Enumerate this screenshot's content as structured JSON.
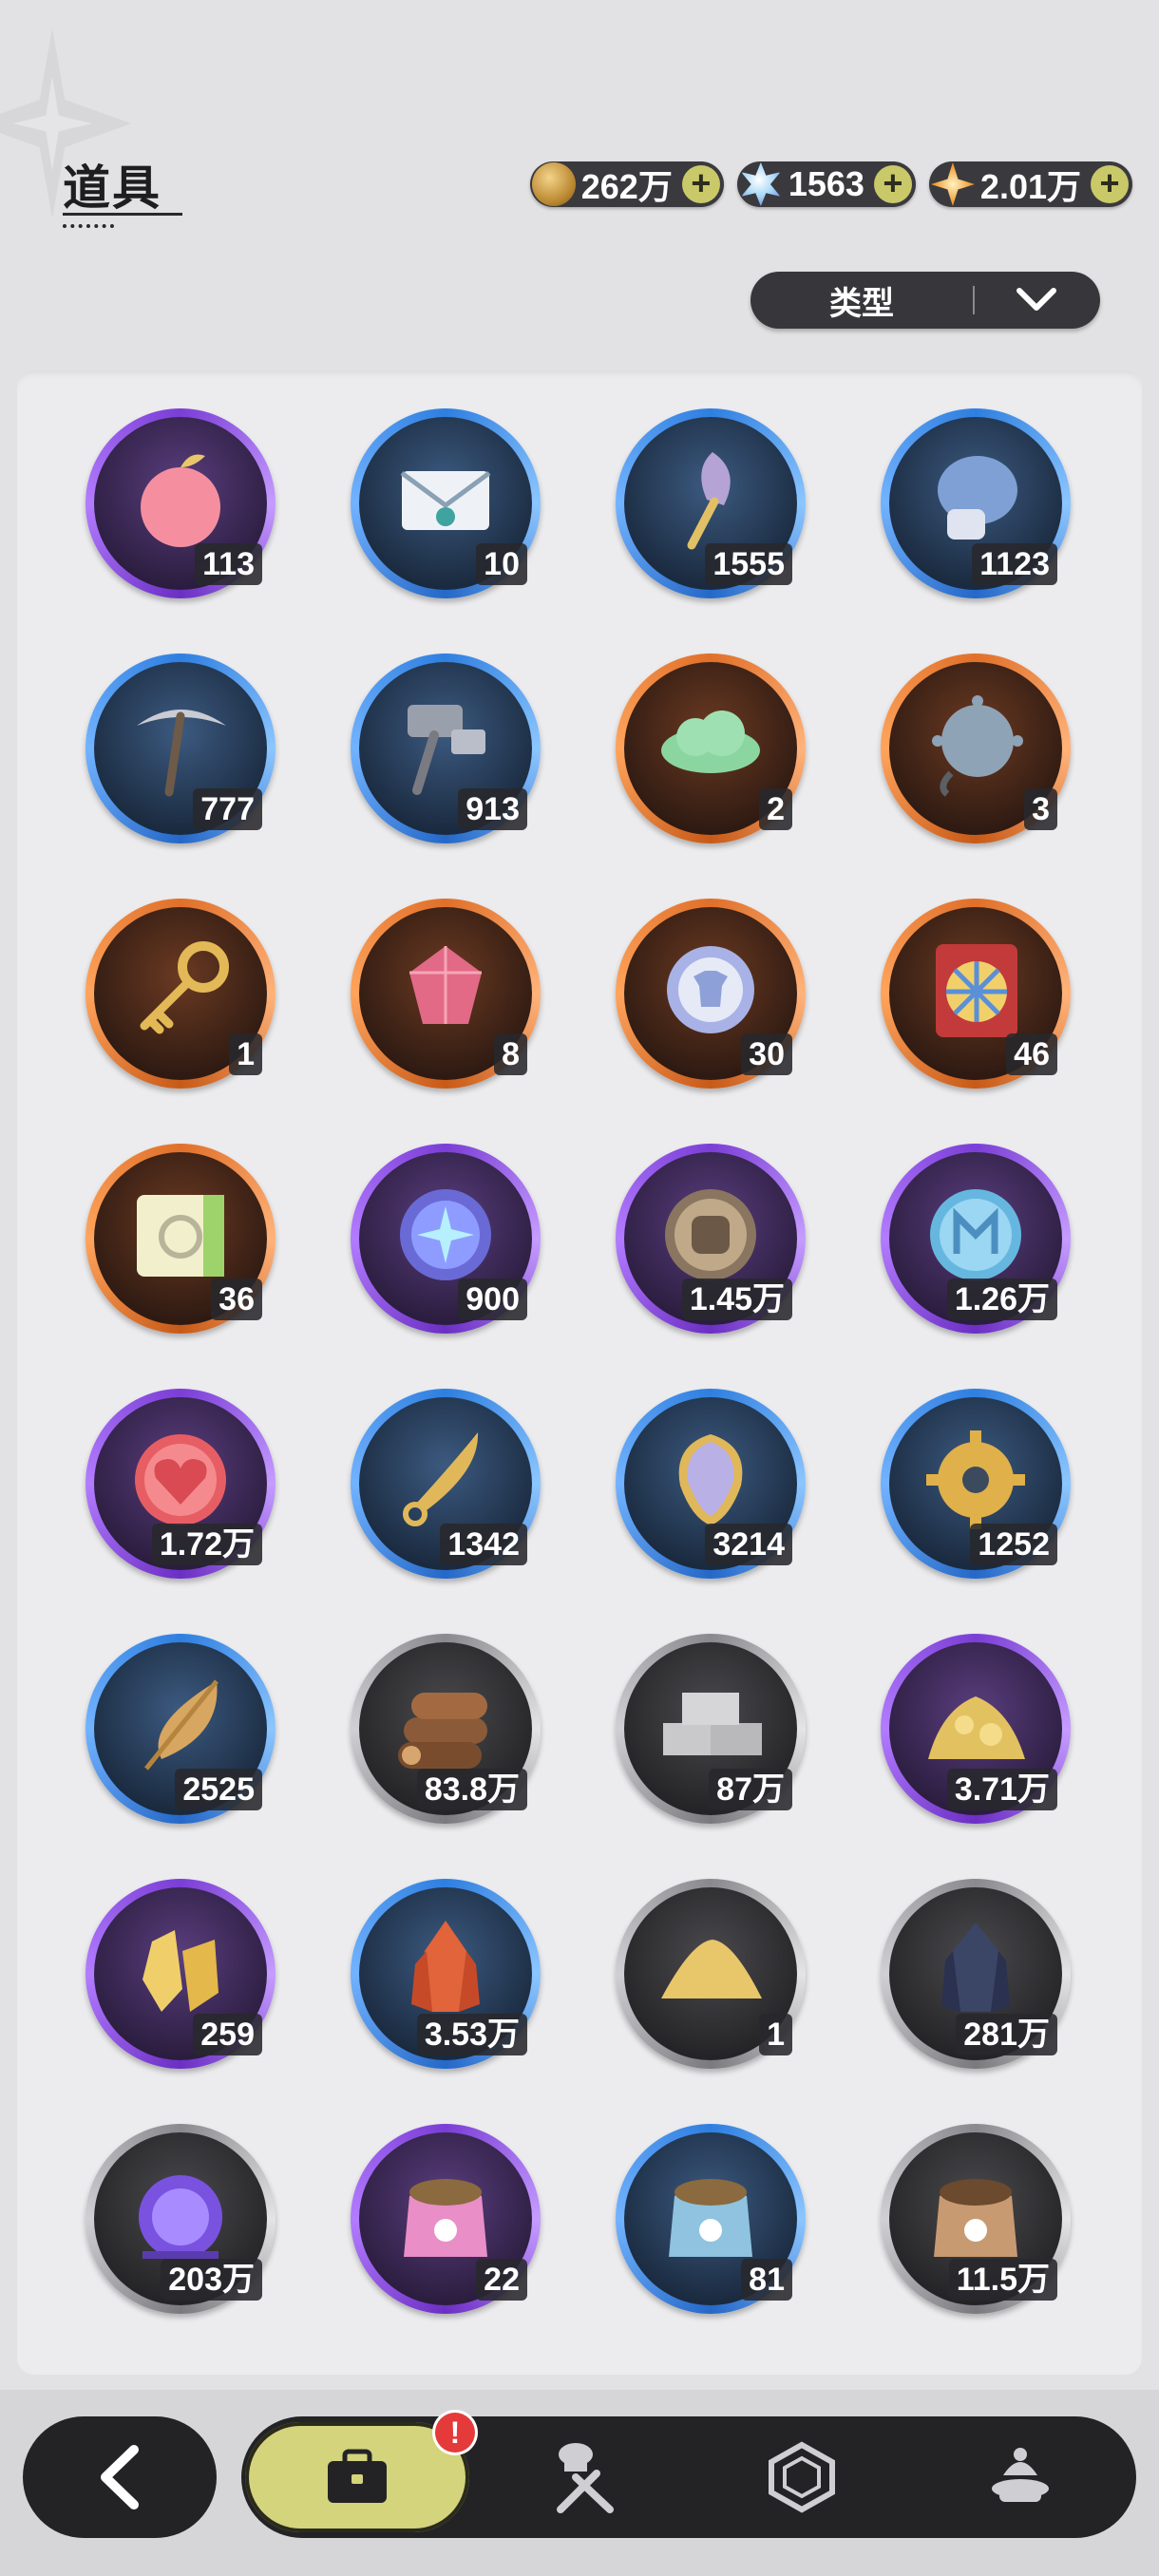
{
  "header": {
    "title": "道具"
  },
  "currencies": [
    {
      "icon": "gold-coin-icon",
      "value": "262万"
    },
    {
      "icon": "crystal-icon",
      "value": "1563"
    },
    {
      "icon": "star-gem-icon",
      "value": "2.01万"
    }
  ],
  "filter": {
    "label": "类型"
  },
  "items": [
    {
      "icon": "apple-icon",
      "rarity": "purple",
      "count": "113"
    },
    {
      "icon": "envelope-icon",
      "rarity": "blue",
      "count": "10"
    },
    {
      "icon": "shovel-icon",
      "rarity": "blue",
      "count": "1555"
    },
    {
      "icon": "boxing-glove-icon",
      "rarity": "blue",
      "count": "1123"
    },
    {
      "icon": "pickaxe-icon",
      "rarity": "blue",
      "count": "777"
    },
    {
      "icon": "hammer-icon",
      "rarity": "blue",
      "count": "913"
    },
    {
      "icon": "cloud-icon",
      "rarity": "orange",
      "count": "2"
    },
    {
      "icon": "spiked-ball-icon",
      "rarity": "orange",
      "count": "3"
    },
    {
      "icon": "golden-key-icon",
      "rarity": "orange",
      "count": "1"
    },
    {
      "icon": "ruby-gem-icon",
      "rarity": "orange",
      "count": "8"
    },
    {
      "icon": "shirt-coin-icon",
      "rarity": "orange",
      "count": "30"
    },
    {
      "icon": "wheel-ticket-icon",
      "rarity": "orange",
      "count": "46"
    },
    {
      "icon": "rainbow-ticket-icon",
      "rarity": "orange",
      "count": "36"
    },
    {
      "icon": "star-coin-icon",
      "rarity": "purple",
      "count": "900"
    },
    {
      "icon": "fist-coin-icon",
      "rarity": "purple",
      "count": "1.45万"
    },
    {
      "icon": "blue-medal-icon",
      "rarity": "purple",
      "count": "1.26万"
    },
    {
      "icon": "heart-coin-icon",
      "rarity": "purple",
      "count": "1.72万"
    },
    {
      "icon": "golden-blade-icon",
      "rarity": "blue",
      "count": "1342"
    },
    {
      "icon": "dragon-scale-icon",
      "rarity": "blue",
      "count": "3214"
    },
    {
      "icon": "gear-icon",
      "rarity": "blue",
      "count": "1252"
    },
    {
      "icon": "golden-leaf-icon",
      "rarity": "blue",
      "count": "2525"
    },
    {
      "icon": "wood-logs-icon",
      "rarity": "grey",
      "count": "83.8万"
    },
    {
      "icon": "stone-bricks-icon",
      "rarity": "grey",
      "count": "87万"
    },
    {
      "icon": "gold-ore-icon",
      "rarity": "purple",
      "count": "3.71万"
    },
    {
      "icon": "gold-crystal-icon",
      "rarity": "purple",
      "count": "259"
    },
    {
      "icon": "red-crystal-icon",
      "rarity": "blue",
      "count": "3.53万"
    },
    {
      "icon": "sand-pile-icon",
      "rarity": "grey",
      "count": "1"
    },
    {
      "icon": "dark-crystal-icon",
      "rarity": "grey",
      "count": "281万"
    },
    {
      "icon": "purple-orb-icon",
      "rarity": "grey",
      "count": "203万"
    },
    {
      "icon": "pink-food-bag-icon",
      "rarity": "purple",
      "count": "22"
    },
    {
      "icon": "blue-food-bag-icon",
      "rarity": "blue",
      "count": "81"
    },
    {
      "icon": "brown-food-bag-icon",
      "rarity": "grey",
      "count": "11.5万"
    }
  ],
  "nav": {
    "tabs": [
      {
        "icon": "bag-icon",
        "active": true,
        "alert": "!"
      },
      {
        "icon": "chef-tools-icon",
        "active": false
      },
      {
        "icon": "hexagon-gem-icon",
        "active": false
      },
      {
        "icon": "dessert-icon",
        "active": false
      }
    ]
  },
  "colors": {
    "background": "#e2e2e4",
    "active_tab": "#d3d47c",
    "rarity_purple": "#7b3ed6",
    "rarity_blue": "#2f7fe0",
    "rarity_orange": "#e0702a",
    "rarity_grey": "#8a8a8e"
  }
}
